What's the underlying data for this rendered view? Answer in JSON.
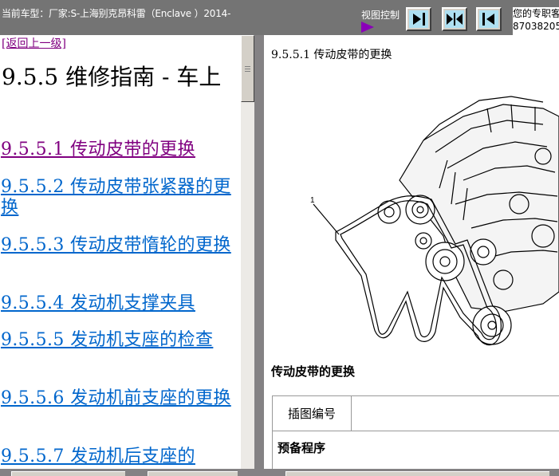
{
  "header": {
    "car_label": "当前车型：厂家:S-上海别克昂科雷（Enclave ）2014-",
    "view_control_label": "视图控制",
    "contact_line1": "您的专职客",
    "contact_line2": "87038205"
  },
  "view_buttons": [
    {
      "icon": "arrow-right-to-bar-icon"
    },
    {
      "icon": "split-view-icon"
    },
    {
      "icon": "bar-arrow-left-icon"
    }
  ],
  "left": {
    "back_link": "[返回上一级]",
    "heading": "9.5.5 维修指南 - 车上",
    "toc": [
      {
        "label": "9.5.5.1 传动皮带的更换",
        "visited": true
      },
      {
        "label": "9.5.5.2 传动皮带张紧器的更换",
        "visited": false
      },
      {
        "label": "9.5.5.3 传动皮带惰轮的更换",
        "visited": false
      },
      {
        "label": "9.5.5.4 发动机支撑夹具",
        "visited": false
      },
      {
        "label": "9.5.5.5 发动机支座的检查",
        "visited": false
      },
      {
        "label": "9.5.5.6 发动机前支座的更换",
        "visited": false
      },
      {
        "label": "9.5.5.7 发动机后支座的",
        "visited": false
      }
    ]
  },
  "right": {
    "title": "9.5.5.1 传动皮带的更换",
    "figure_callout": "1",
    "figure_caption": "传动皮带的更换",
    "table": {
      "col1_header": "插图编号",
      "col2_header": "",
      "section_label": "预备程序"
    }
  },
  "colors": {
    "link": "#0066cc",
    "visited_link": "#800080",
    "toolbar_bg": "#747474",
    "button_face": "#aee0f2",
    "view_arrow": "#8a00b8"
  }
}
